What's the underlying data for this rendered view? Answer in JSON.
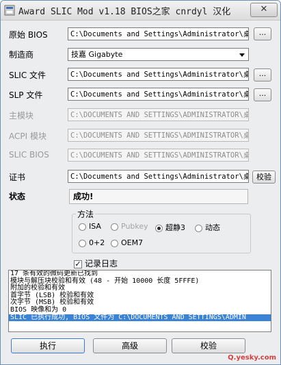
{
  "window": {
    "title": "Award SLIC Mod v1.18  BIOS之家 cnrdyl 汉化",
    "close_label": "✕"
  },
  "rows": [
    {
      "label": "原始 BIOS",
      "value": "C:\\Documents and Settings\\Administrator\\桌面",
      "browse": "..."
    },
    {
      "label": "制造商",
      "value": "技嘉 Gigabyte"
    },
    {
      "label": "SLIC 文件",
      "value": "C:\\Documents and Settings\\Administrator\\桌面",
      "browse": "..."
    },
    {
      "label": "SLP 文件",
      "value": "C:\\Documents and Settings\\Administrator\\桌面",
      "browse": "..."
    },
    {
      "label": "主模块",
      "value": "C:\\DOCUMENTS AND SETTINGS\\ADMINISTRATOR\\桌面"
    },
    {
      "label": "ACPI 模块",
      "value": "C:\\DOCUMENTS AND SETTINGS\\ADMINISTRATOR\\桌面"
    },
    {
      "label": "SLIC BIOS",
      "value": "C:\\DOCUMENTS AND SETTINGS\\ADMINISTRATOR\\桌面"
    },
    {
      "label": "证书",
      "value": "C:\\Documents and Settings\\Administrator\\桌面",
      "button": "校验"
    }
  ],
  "status": {
    "label": "状态",
    "value": "成功!"
  },
  "method": {
    "title": "方法",
    "options": [
      "ISA",
      "Pubkey",
      "超静3",
      "动态",
      "0+2",
      "OEM7"
    ],
    "selected": "超静3"
  },
  "log_checkbox": {
    "label": "记录日志",
    "checked": true
  },
  "log_lines": [
    "17 条有效的微码更新已找到",
    "模块与解压块校验和有效 (48 - 开始 10000 长度 5FFFE)",
    "附加的校验和有效",
    "首字节 (LSB) 校验和有效",
    "次字节 (MSB) 校验和有效",
    "BIOS 映像和为 0",
    "SLIC 已执行成功, BIOS 文件为 C:\\DOCUMENTS AND SETTINGS\\ADMIN"
  ],
  "buttons": {
    "run": "执行",
    "advanced": "高级",
    "verify": "校验"
  },
  "watermark": "Q.yesky.com"
}
